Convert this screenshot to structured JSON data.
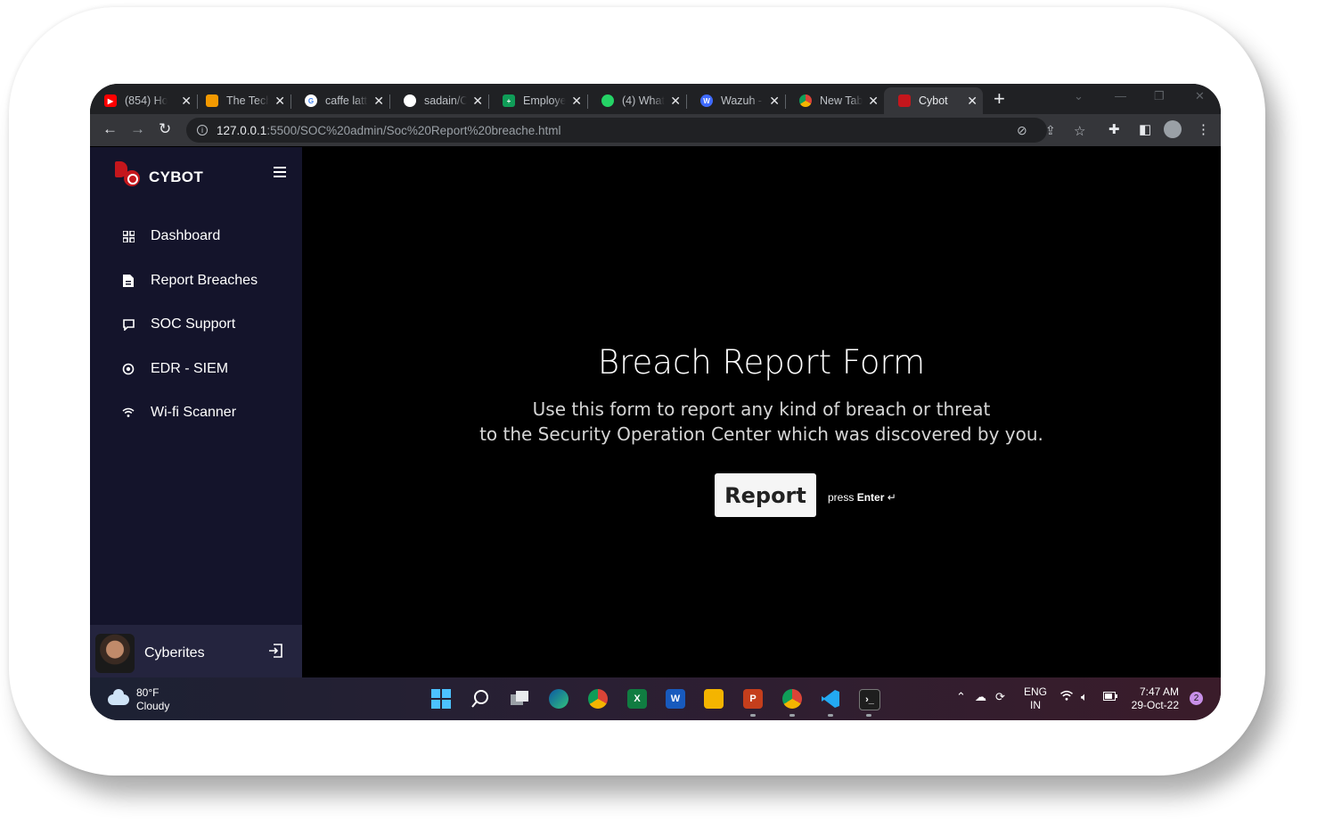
{
  "browser": {
    "tabs": [
      {
        "title": "(854) Ho",
        "icon": "youtube-icon",
        "color": "#ff0000"
      },
      {
        "title": "The Tech",
        "icon": "site-icon",
        "color": "#f29900"
      },
      {
        "title": "caffe latt",
        "icon": "google-icon",
        "color": "#4285f4"
      },
      {
        "title": "sadain/C",
        "icon": "github-icon",
        "color": "#ffffff"
      },
      {
        "title": "Employe",
        "icon": "sheets-icon",
        "color": "#0f9d58"
      },
      {
        "title": "(4) What",
        "icon": "whatsapp-icon",
        "color": "#25d366"
      },
      {
        "title": "Wazuh -",
        "icon": "wazuh-icon",
        "color": "#3f6bff"
      },
      {
        "title": "New Tab",
        "icon": "chrome-icon",
        "color": "#dddddd"
      },
      {
        "title": "Cybot",
        "icon": "cybot-icon",
        "color": "#c4161c",
        "active": true
      }
    ],
    "url_host": "127.0.0.1",
    "url_path": ":5500/SOC%20admin/Soc%20Report%20breache.html"
  },
  "sidebar": {
    "brand": "CYBOT",
    "items": [
      {
        "label": "Dashboard",
        "icon": "grid-icon"
      },
      {
        "label": "Report Breaches",
        "icon": "document-icon"
      },
      {
        "label": "SOC Support",
        "icon": "chat-icon"
      },
      {
        "label": "EDR - SIEM",
        "icon": "radar-icon"
      },
      {
        "label": "Wi-fi Scanner",
        "icon": "wifi-icon"
      }
    ],
    "user": {
      "name": "Cyberites"
    }
  },
  "main": {
    "title": "Breach Report Form",
    "desc_line1": "Use this form to report any kind of breach or threat",
    "desc_line2": "to the Security Operation Center which was discovered by you.",
    "button_label": "Report",
    "hint_prefix": "press",
    "hint_key": "Enter",
    "hint_symbol": "↵"
  },
  "taskbar": {
    "temperature": "80°F",
    "weather": "Cloudy",
    "lang_line1": "ENG",
    "lang_line2": "IN",
    "time": "7:47 AM",
    "date": "29-Oct-22",
    "notifications": "2"
  },
  "colors": {
    "sidebar_bg": "#14142b",
    "brand_red": "#c4161c",
    "main_bg": "#000000"
  }
}
